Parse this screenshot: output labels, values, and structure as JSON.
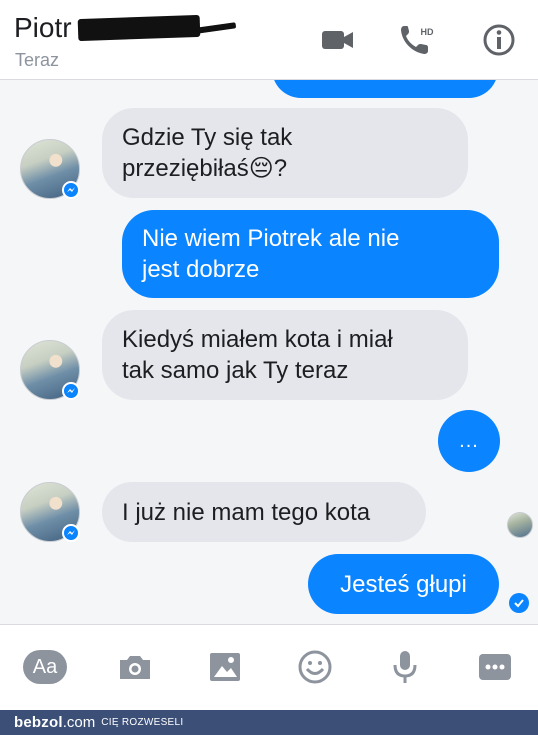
{
  "header": {
    "contact_name": "Piotr",
    "status": "Teraz",
    "hd_label": "HD"
  },
  "messages": [
    {
      "direction": "incoming",
      "lines": [
        "Gdzie Ty się tak",
        "przeziębiłaś😔?"
      ]
    },
    {
      "direction": "outgoing",
      "lines": [
        "Nie wiem Piotrek ale nie",
        "jest dobrze"
      ]
    },
    {
      "direction": "incoming",
      "lines": [
        "Kiedyś miałem kota i miał",
        "tak samo jak Ty teraz"
      ]
    },
    {
      "direction": "outgoing",
      "typing": "..."
    },
    {
      "direction": "incoming",
      "lines": [
        "I już nie mam tego kota"
      ]
    },
    {
      "direction": "outgoing",
      "lines": [
        "Jesteś głupi"
      ]
    }
  ],
  "composer": {
    "aa_label": "Aa",
    "tools": [
      "text-format-icon",
      "camera-icon",
      "gallery-icon",
      "emoji-icon",
      "microphone-icon",
      "more-icon"
    ]
  },
  "footer": {
    "brand": "bebzol",
    "brand_suffix": ".com",
    "tagline": "CIĘ ROZWESELI"
  },
  "colors": {
    "accent": "#0a84ff",
    "incoming_bubble": "#e4e6eb",
    "footer_bar": "#3b4f77"
  }
}
